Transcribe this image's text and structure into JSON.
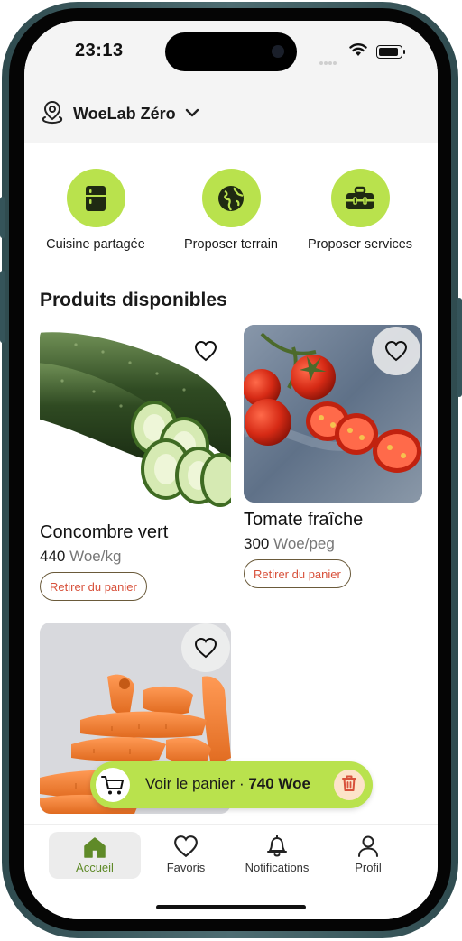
{
  "status_bar": {
    "time": "23:13"
  },
  "location": {
    "name": "WoeLab Zéro"
  },
  "quick_actions": [
    {
      "label": "Cuisine partagée",
      "icon": "fridge-icon"
    },
    {
      "label": "Proposer terrain",
      "icon": "globe-icon"
    },
    {
      "label": "Proposer services",
      "icon": "toolbox-icon"
    }
  ],
  "section_title": "Produits disponibles",
  "products": [
    {
      "name": "Concombre vert",
      "price": "440",
      "unit": "Woe/kg",
      "action": "Retirer du panier",
      "image": "cucumber"
    },
    {
      "name": "Tomate fraîche",
      "price": "300",
      "unit": "Woe/peg",
      "action": "Retirer du panier",
      "image": "tomato"
    },
    {
      "name": "",
      "image": "carrot"
    }
  ],
  "cart_bar": {
    "label": "Voir le panier · ",
    "total": "740 Woe"
  },
  "bottom_nav": [
    {
      "label": "Accueil",
      "icon": "home-icon",
      "active": true
    },
    {
      "label": "Favoris",
      "icon": "heart-icon",
      "active": false
    },
    {
      "label": "Notifications",
      "icon": "bell-icon",
      "active": false
    },
    {
      "label": "Profil",
      "icon": "user-icon",
      "active": false
    }
  ],
  "colors": {
    "accent": "#b9e24d",
    "active_nav": "#5f8a28",
    "remove_text": "#d8513b",
    "trash_bg": "#fde3c9"
  }
}
